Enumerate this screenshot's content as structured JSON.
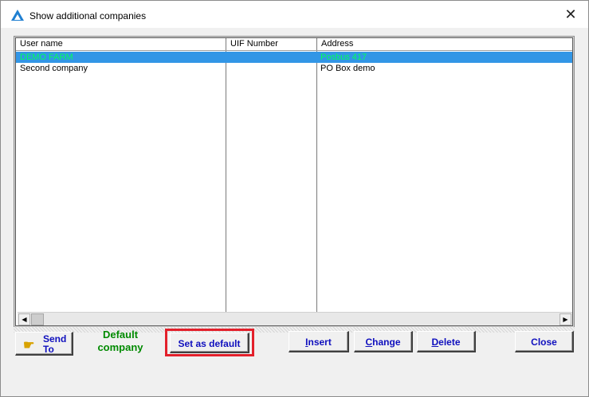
{
  "window": {
    "title": "Show additional companies",
    "close_glyph": "✕"
  },
  "grid": {
    "columns": [
      "User name",
      "UIF Number",
      "Address"
    ],
    "rows": [
      {
        "user_name": "DEMO FARM",
        "uif_number": "",
        "address": "Posbus 417",
        "selected": true
      },
      {
        "user_name": "Second company",
        "uif_number": "",
        "address": "PO Box demo",
        "selected": false
      }
    ],
    "selection_bg": "#3296e6",
    "selection_fg": "#00ff5a"
  },
  "scrollbar": {
    "left_arrow": "◀",
    "right_arrow": "▶"
  },
  "buttons": {
    "send_to_line1": "Send",
    "send_to_line2": "To",
    "send_icon": "pointing-hand-icon",
    "default_company_line1": "Default",
    "default_company_line2": "company",
    "set_as_default": "Set as default",
    "insert_first": "I",
    "insert_rest": "nsert",
    "change_first": "C",
    "change_rest": "hange",
    "delete_first": "D",
    "delete_rest": "elete",
    "close": "Close"
  },
  "colors": {
    "button_text": "#0f0fbe",
    "default_label": "#008a00",
    "highlight_border": "#e3202b"
  }
}
